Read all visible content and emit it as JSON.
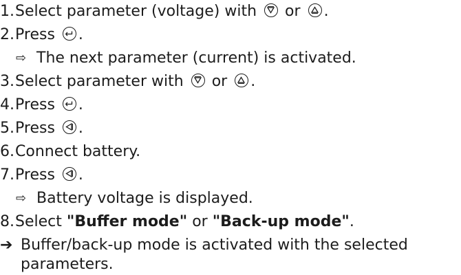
{
  "steps": [
    {
      "num": "1.",
      "pre": "Select parameter (voltage) with",
      "mid": "or",
      "post": "."
    },
    {
      "num": "2.",
      "pre": "Press",
      "post": "."
    },
    {
      "sub": "The next parameter (current) is activated."
    },
    {
      "num": "3.",
      "pre": "Select parameter with",
      "mid": "or",
      "post": "."
    },
    {
      "num": "4.",
      "pre": "Press",
      "post": "."
    },
    {
      "num": "5.",
      "pre": "Press",
      "post": "."
    },
    {
      "num": "6.",
      "text": "Connect battery."
    },
    {
      "num": "7.",
      "pre": "Press",
      "post": "."
    },
    {
      "sub": "Battery voltage is displayed."
    },
    {
      "num": "8.",
      "pre": "Select",
      "bold1": "\"Buffer mode\"",
      "mid": "or",
      "bold2": "\"Back-up mode\"",
      "post": "."
    }
  ],
  "result": {
    "line1": "Buffer/back-up mode is activated with the selected",
    "line2": "parameters."
  },
  "icons": {
    "down": "down-triangle-key-icon",
    "up": "up-triangle-key-icon",
    "enter": "enter-key-icon",
    "left": "left-triangle-key-icon",
    "sub_arrow": "hollow-right-arrow-icon",
    "result_arrow": "bold-right-arrow-icon"
  }
}
